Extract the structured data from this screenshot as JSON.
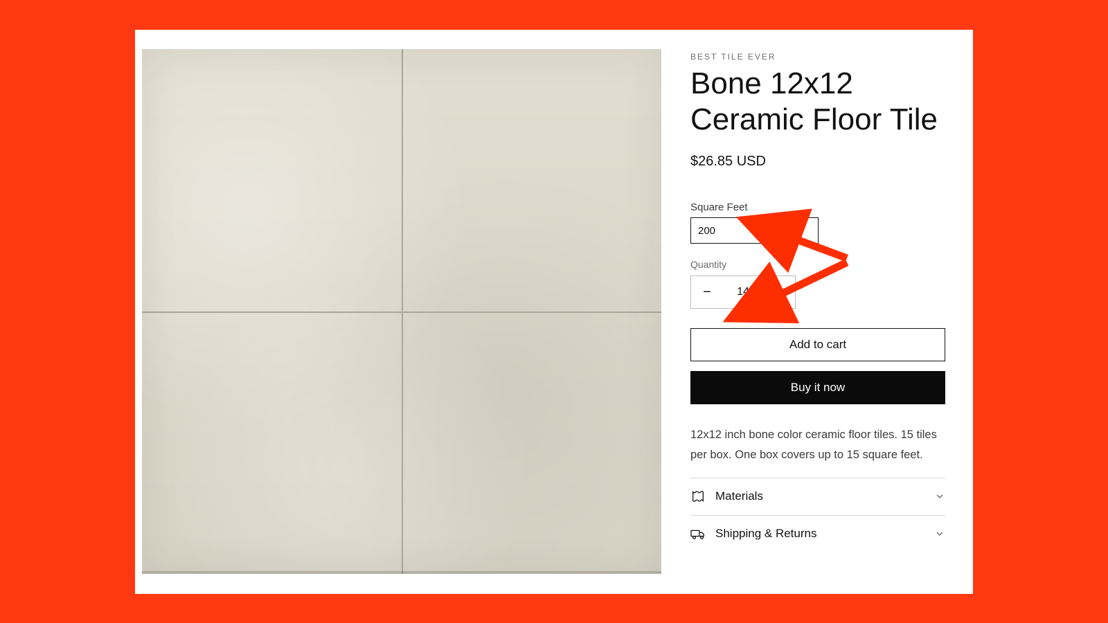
{
  "colors": {
    "accent": "#ff3a12",
    "text": "#121212",
    "solid_btn": "#0b0b0b"
  },
  "product": {
    "vendor": "BEST TILE EVER",
    "title": "Bone 12x12 Ceramic Floor Tile",
    "price": "$26.85 USD",
    "description": "12x12 inch bone color ceramic floor tiles.  15 tiles per box.  One box covers up to 15 square feet."
  },
  "form": {
    "sqft_label": "Square Feet",
    "sqft_value": "200",
    "qty_label": "Quantity",
    "qty_value": "14",
    "minus_glyph": "−",
    "plus_glyph": "+"
  },
  "buttons": {
    "add_to_cart": "Add to cart",
    "buy_now": "Buy it now"
  },
  "accordion": {
    "items": [
      {
        "label": "Materials"
      },
      {
        "label": "Shipping & Returns"
      }
    ]
  }
}
